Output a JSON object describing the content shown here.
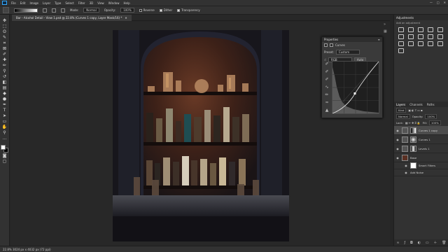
{
  "menu": {
    "items": [
      "File",
      "Edit",
      "Image",
      "Layer",
      "Type",
      "Select",
      "Filter",
      "3D",
      "View",
      "Window",
      "Help"
    ],
    "window_controls": [
      "—",
      "□",
      "✕"
    ]
  },
  "options": {
    "mode_label": "Mode:",
    "mode_value": "Normal",
    "opacity_label": "Opacity:",
    "opacity_value": "100%",
    "reverse": "Reverse",
    "dither": "Dither",
    "transparency": "Transparency"
  },
  "document": {
    "tab_title": "Bar - Alcohol Detail - View 1.psd @ 22.8% (Curves 1 copy, Layer Mask/16) *",
    "close": "✕"
  },
  "status": {
    "text": "22.8%    3024 px x 4032 px (72 ppi)"
  },
  "properties": {
    "title": "Properties",
    "layer_type": "Curves",
    "preset_label": "Preset:",
    "preset_value": "Custom",
    "channel_value": "RGB",
    "auto_label": "Auto"
  },
  "adjustments": {
    "title": "Adjustments",
    "subtitle": "Add an adjustment"
  },
  "layers": {
    "tabs": [
      "Layers",
      "Channels",
      "Paths"
    ],
    "kind_label": "Kind",
    "blend_value": "Normal",
    "opacity_label": "Opacity:",
    "opacity_value": "100%",
    "lock_label": "Lock:",
    "fill_label": "Fill:",
    "fill_value": "100%",
    "items": [
      {
        "name": "Curves 1 copy",
        "selected": true
      },
      {
        "name": "Curves 1",
        "selected": false
      },
      {
        "name": "Levels 1",
        "selected": false
      },
      {
        "name": "Base",
        "selected": false
      },
      {
        "name": "Smart Filters",
        "selected": false
      },
      {
        "name": "Add Noise",
        "selected": false
      }
    ],
    "footer_icons": [
      "link-icon",
      "fx-icon",
      "mask-icon",
      "adjust-icon",
      "folder-icon",
      "new-layer-icon",
      "trash-icon"
    ]
  },
  "colors": {
    "accent": "#31a8ff",
    "panel": "#323232",
    "canvas": "#282828"
  }
}
